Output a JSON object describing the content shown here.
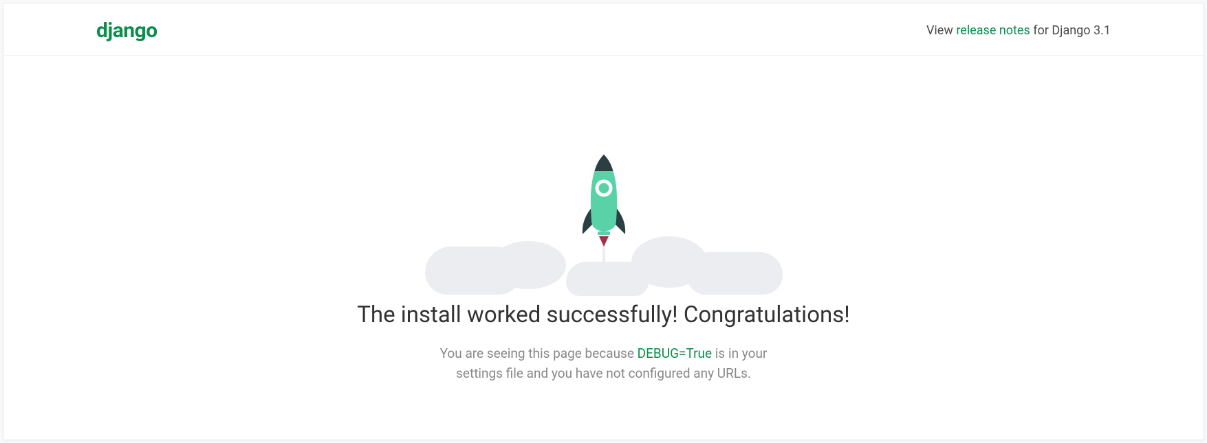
{
  "header": {
    "logo": "django",
    "view_text": "View ",
    "release_link": "release notes",
    "for_text": " for Django 3.1"
  },
  "main": {
    "headline": "The install worked successfully! Congratulations!",
    "sub_before": "You are seeing this page because ",
    "debug_flag": "DEBUG=True",
    "sub_after": " is in your settings file and you have not configured any URLs."
  }
}
